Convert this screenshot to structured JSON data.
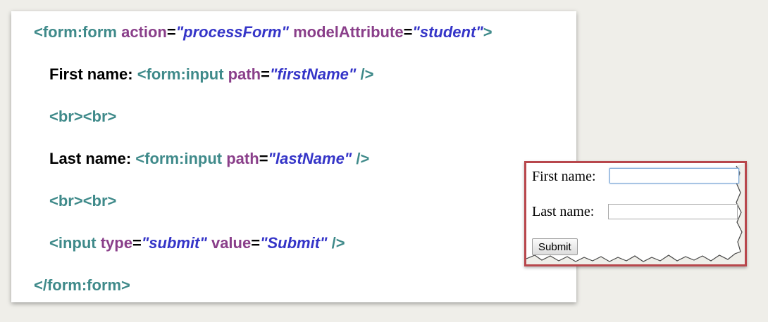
{
  "code": {
    "line1": {
      "open": "<form:form",
      "attr1": "action",
      "eq": "=",
      "val1": "\"processForm\"",
      "attr2": "modelAttribute",
      "val2": "\"student\"",
      "close": ">"
    },
    "line2": {
      "label": "First name:",
      "open": "<form:input",
      "attr": "path",
      "eq": "=",
      "val": "\"firstName\"",
      "close": "/>"
    },
    "line3": {
      "text": "<br><br>"
    },
    "line4": {
      "label": "Last name:",
      "open": "<form:input",
      "attr": "path",
      "eq": "=",
      "val": "\"lastName\"",
      "close": "/>"
    },
    "line5": {
      "text": "<br><br>"
    },
    "line6": {
      "open": "<input",
      "attr1": "type",
      "eq": "=",
      "val1": "\"submit\"",
      "attr2": "value",
      "val2": "\"Submit\"",
      "close": "/>"
    },
    "line7": {
      "text": "</form:form>"
    }
  },
  "preview": {
    "first_label": "First name:",
    "first_value": "",
    "last_label": "Last name:",
    "last_value": "",
    "submit_label": "Submit"
  },
  "colors": {
    "tag": "#3f8a8a",
    "attribute": "#8a3f8a",
    "string": "#3535c8",
    "preview_border": "#b8474c"
  }
}
